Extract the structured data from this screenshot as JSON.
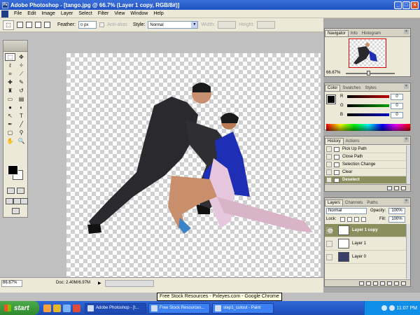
{
  "window": {
    "title": "Adobe Photoshop - [tango.jpg @ 66.7% (Layer 1 copy, RGB/8#)]",
    "min": "_",
    "max": "□",
    "close": "×"
  },
  "menu": [
    "File",
    "Edit",
    "Image",
    "Layer",
    "Select",
    "Filter",
    "View",
    "Window",
    "Help"
  ],
  "options": {
    "feather_label": "Feather:",
    "feather_value": "0 px",
    "antialias_label": "Anti-alias",
    "style_label": "Style:",
    "style_value": "Normal",
    "width_label": "Width:",
    "height_label": "Height:"
  },
  "status": {
    "zoom": "66.67%",
    "doc": "Doc: 2.40M/6.97M",
    "arrow": "▶"
  },
  "tooltip": "Free Stock Resources - Pxleyes.com - Google Chrome",
  "navigator": {
    "tabs": [
      "Navigator",
      "Info",
      "Histogram"
    ],
    "zoom": "66.67%"
  },
  "color": {
    "tabs": [
      "Color",
      "Swatches",
      "Styles"
    ],
    "rows": [
      {
        "label": "R",
        "value": "0",
        "color": "#c00000"
      },
      {
        "label": "G",
        "value": "0",
        "color": "#00a000"
      },
      {
        "label": "B",
        "value": "0",
        "color": "#0000c0"
      }
    ]
  },
  "history": {
    "tabs": [
      "History",
      "Actions"
    ],
    "items": [
      "Pick Up Path",
      "Close Path",
      "Selection Change",
      "Clear",
      "Deselect"
    ],
    "active_index": 4
  },
  "layers": {
    "tabs": [
      "Layers",
      "Channels",
      "Paths"
    ],
    "blend": "Normal",
    "opacity_label": "Opacity:",
    "opacity": "100%",
    "lock_label": "Lock:",
    "fill_label": "Fill:",
    "fill": "100%",
    "rows": [
      "Layer 1 copy",
      "Layer 1",
      "Layer 0"
    ],
    "eye": "👁"
  },
  "taskbar": {
    "start": "start",
    "tasks": [
      "Adobe Photoshop - [t...",
      "Free Stock Resources...",
      "step1_cutout - Paint"
    ],
    "clock": "11:07 PM"
  }
}
